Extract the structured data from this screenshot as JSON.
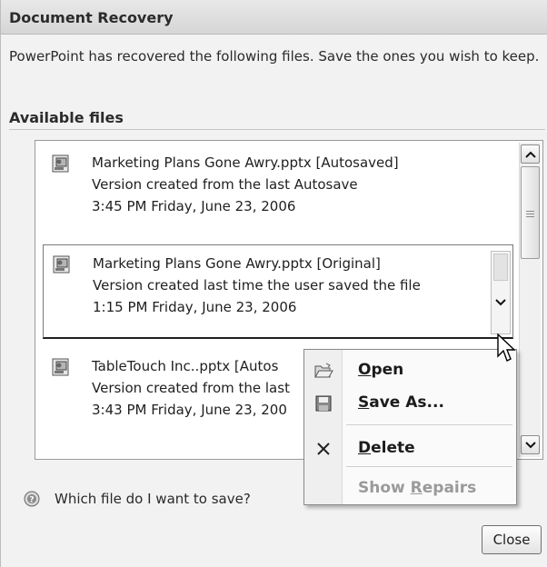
{
  "dialog": {
    "title": "Document Recovery",
    "intro": "PowerPoint has recovered the following files.  Save the ones you wish to keep.",
    "section_heading": "Available files"
  },
  "files": [
    {
      "icon": "pptx-file-icon",
      "name_line": "Marketing Plans Gone Awry.pptx  [Autosaved]",
      "desc_line": "Version created from the last Autosave",
      "time_line": "3:45 PM Friday, June 23, 2006"
    },
    {
      "icon": "pptx-file-icon",
      "name_line": "Marketing Plans Gone Awry.pptx  [Original]",
      "desc_line": "Version created last time the user saved the file",
      "time_line": "1:15 PM Friday, June 23, 2006",
      "selected": true
    },
    {
      "icon": "pptx-file-icon",
      "name_line": "TableTouch Inc..pptx  [Autos",
      "desc_line": "Version created from the last",
      "time_line": "3:43 PM Friday, June 23, 200"
    }
  ],
  "context_menu": {
    "items": [
      {
        "label": "Open",
        "accel": "O",
        "icon": "open-folder-icon",
        "enabled": true
      },
      {
        "label": "Save As...",
        "accel": "S",
        "icon": "save-disk-icon",
        "enabled": true
      },
      {
        "label": "Delete",
        "accel": "D",
        "icon": "delete-x-icon",
        "enabled": true
      },
      {
        "label": "Show Repairs",
        "accel": "R",
        "icon": "",
        "enabled": false
      }
    ]
  },
  "footer": {
    "help_text": "Which file do I want to save?",
    "close_label": "Close"
  },
  "colors": {
    "dialog_bg": "#f2f2f2",
    "list_bg": "#ffffff",
    "menu_bg": "#fafafa",
    "disabled_text": "#9a9a9a"
  }
}
